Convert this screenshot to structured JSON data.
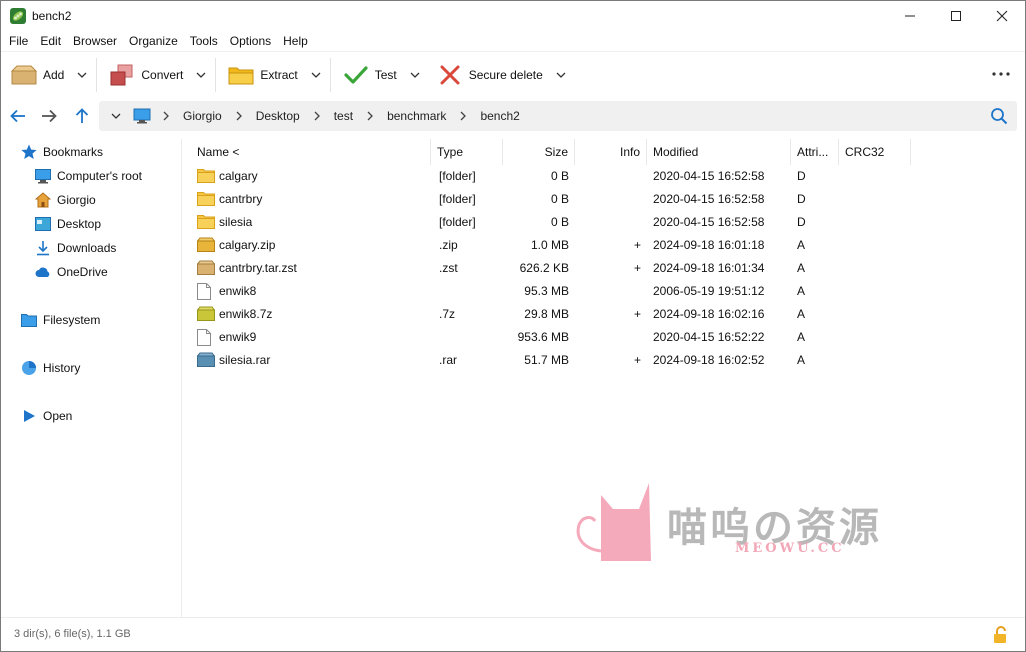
{
  "window": {
    "title": "bench2"
  },
  "menu": [
    "File",
    "Edit",
    "Browser",
    "Organize",
    "Tools",
    "Options",
    "Help"
  ],
  "toolbar": {
    "add_label": "Add",
    "convert_label": "Convert",
    "extract_label": "Extract",
    "test_label": "Test",
    "secure_delete_label": "Secure delete"
  },
  "breadcrumb": [
    "Giorgio",
    "Desktop",
    "test",
    "benchmark",
    "bench2"
  ],
  "sidebar": {
    "bookmarks": "Bookmarks",
    "items": [
      "Computer's root",
      "Giorgio",
      "Desktop",
      "Downloads",
      "OneDrive"
    ],
    "filesystem": "Filesystem",
    "history": "History",
    "open": "Open"
  },
  "columns": {
    "name": "Name <",
    "type": "Type",
    "size": "Size",
    "info": "Info",
    "modified": "Modified",
    "attrib": "Attri...",
    "crc32": "CRC32"
  },
  "files": [
    {
      "name": "calgary",
      "type": "[folder]",
      "size": "0 B",
      "info": "",
      "modified": "2020-04-15 16:52:58",
      "attrib": "D",
      "icon": "folder-icon"
    },
    {
      "name": "cantrbry",
      "type": "[folder]",
      "size": "0 B",
      "info": "",
      "modified": "2020-04-15 16:52:58",
      "attrib": "D",
      "icon": "folder-icon"
    },
    {
      "name": "silesia",
      "type": "[folder]",
      "size": "0 B",
      "info": "",
      "modified": "2020-04-15 16:52:58",
      "attrib": "D",
      "icon": "folder-icon"
    },
    {
      "name": "calgary.zip",
      "type": ".zip",
      "size": "1.0 MB",
      "info": "+",
      "modified": "2024-09-18 16:01:18",
      "attrib": "A",
      "icon": "zip-archive-icon"
    },
    {
      "name": "cantrbry.tar.zst",
      "type": ".zst",
      "size": "626.2 KB",
      "info": "+",
      "modified": "2024-09-18 16:01:34",
      "attrib": "A",
      "icon": "zst-archive-icon"
    },
    {
      "name": "enwik8",
      "type": "",
      "size": "95.3 MB",
      "info": "",
      "modified": "2006-05-19 19:51:12",
      "attrib": "A",
      "icon": "file-icon"
    },
    {
      "name": "enwik8.7z",
      "type": ".7z",
      "size": "29.8 MB",
      "info": "+",
      "modified": "2024-09-18 16:02:16",
      "attrib": "A",
      "icon": "7z-archive-icon"
    },
    {
      "name": "enwik9",
      "type": "",
      "size": "953.6 MB",
      "info": "",
      "modified": "2020-04-15 16:52:22",
      "attrib": "A",
      "icon": "file-icon"
    },
    {
      "name": "silesia.rar",
      "type": ".rar",
      "size": "51.7 MB",
      "info": "+",
      "modified": "2024-09-18 16:02:52",
      "attrib": "A",
      "icon": "rar-archive-icon"
    }
  ],
  "watermark": {
    "text": "喵呜の资源",
    "sub": "MEOWU.CC"
  },
  "status": {
    "text": "3 dir(s), 6 file(s), 1.1 GB"
  },
  "colors": {
    "folder": "#f6c744",
    "accent_blue": "#1e74c9",
    "check_green": "#3aa63a",
    "delete_red": "#d9483b",
    "watermark_pink": "#f5aabb"
  }
}
